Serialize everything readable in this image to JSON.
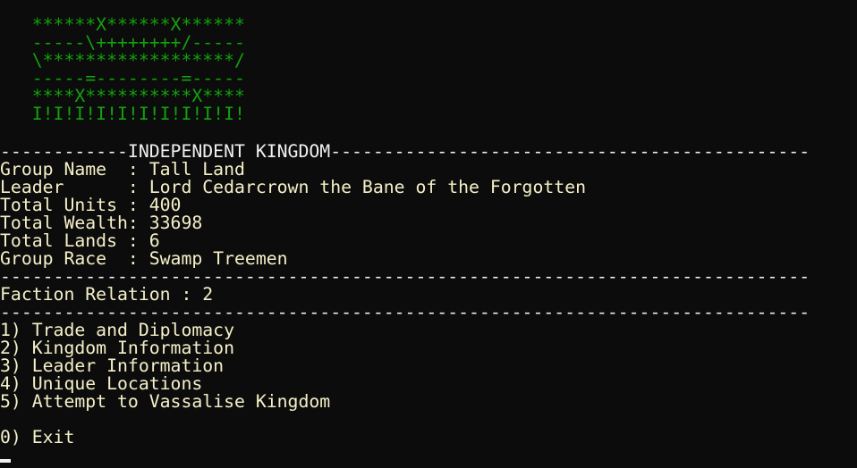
{
  "banner": [
    "   ******X******X******",
    "   -----\\++++++++/-----",
    "   \\******************/",
    "   -----=--------=-----",
    "   ****X**********X****",
    "   I!I!I!I!I!I!I!I!I!I!"
  ],
  "header": "------------INDEPENDENT KINGDOM---------------------------------------------",
  "info": [
    "Group Name  : Tall Land",
    "Leader      : Lord Cedarcrown the Bane of the Forgotten",
    "Total Units : 400",
    "Total Wealth: 33698",
    "Total Lands : 6",
    "Group Race  : Swamp Treemen"
  ],
  "separator1": "----------------------------------------------------------------------------",
  "faction_relation": "Faction Relation : 2",
  "separator2": "----------------------------------------------------------------------------",
  "menu": [
    "1) Trade and Diplomacy",
    "2) Kingdom Information",
    "3) Leader Information",
    "4) Unique Locations",
    "5) Attempt to Vassalise Kingdom"
  ],
  "exit": "0) Exit"
}
